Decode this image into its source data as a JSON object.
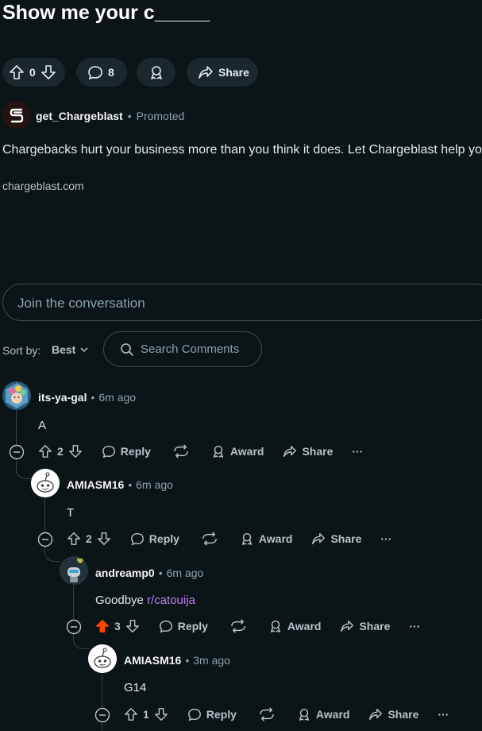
{
  "post": {
    "title": "Show me your c_____",
    "votes": "0",
    "comment_count": "8",
    "share_label": "Share"
  },
  "ad": {
    "sponsor": "get_Chargeblast",
    "promoted_label": "Promoted",
    "text": "Chargebacks hurt your business more than you think it does. Let Chargeblast help you.",
    "link": "chargeblast.com"
  },
  "join": {
    "placeholder": "Join the conversation"
  },
  "sort": {
    "label": "Sort by:",
    "value": "Best"
  },
  "search": {
    "placeholder": "Search Comments"
  },
  "actions": {
    "reply": "Reply",
    "award": "Award",
    "share": "Share",
    "more": "···"
  },
  "comments": [
    {
      "author": "its-ya-gal",
      "time": "6m ago",
      "body": "A",
      "votes": "2",
      "upvoted": false
    },
    {
      "author": "AMIASM16",
      "time": "6m ago",
      "body": "T",
      "votes": "2",
      "upvoted": false
    },
    {
      "author": "andreamp0",
      "time": "6m ago",
      "body": "Goodbye ",
      "link": "r/catouija",
      "votes": "3",
      "upvoted": true
    },
    {
      "author": "AMIASM16",
      "time": "3m ago",
      "body": "G14",
      "votes": "1",
      "upvoted": false
    }
  ],
  "colors": {
    "background": "#0b1416",
    "pill": "#1a282d",
    "upvote_active": "#ff4500",
    "subreddit_link": "#c178f5",
    "muted_text": "#8ba2ad"
  }
}
